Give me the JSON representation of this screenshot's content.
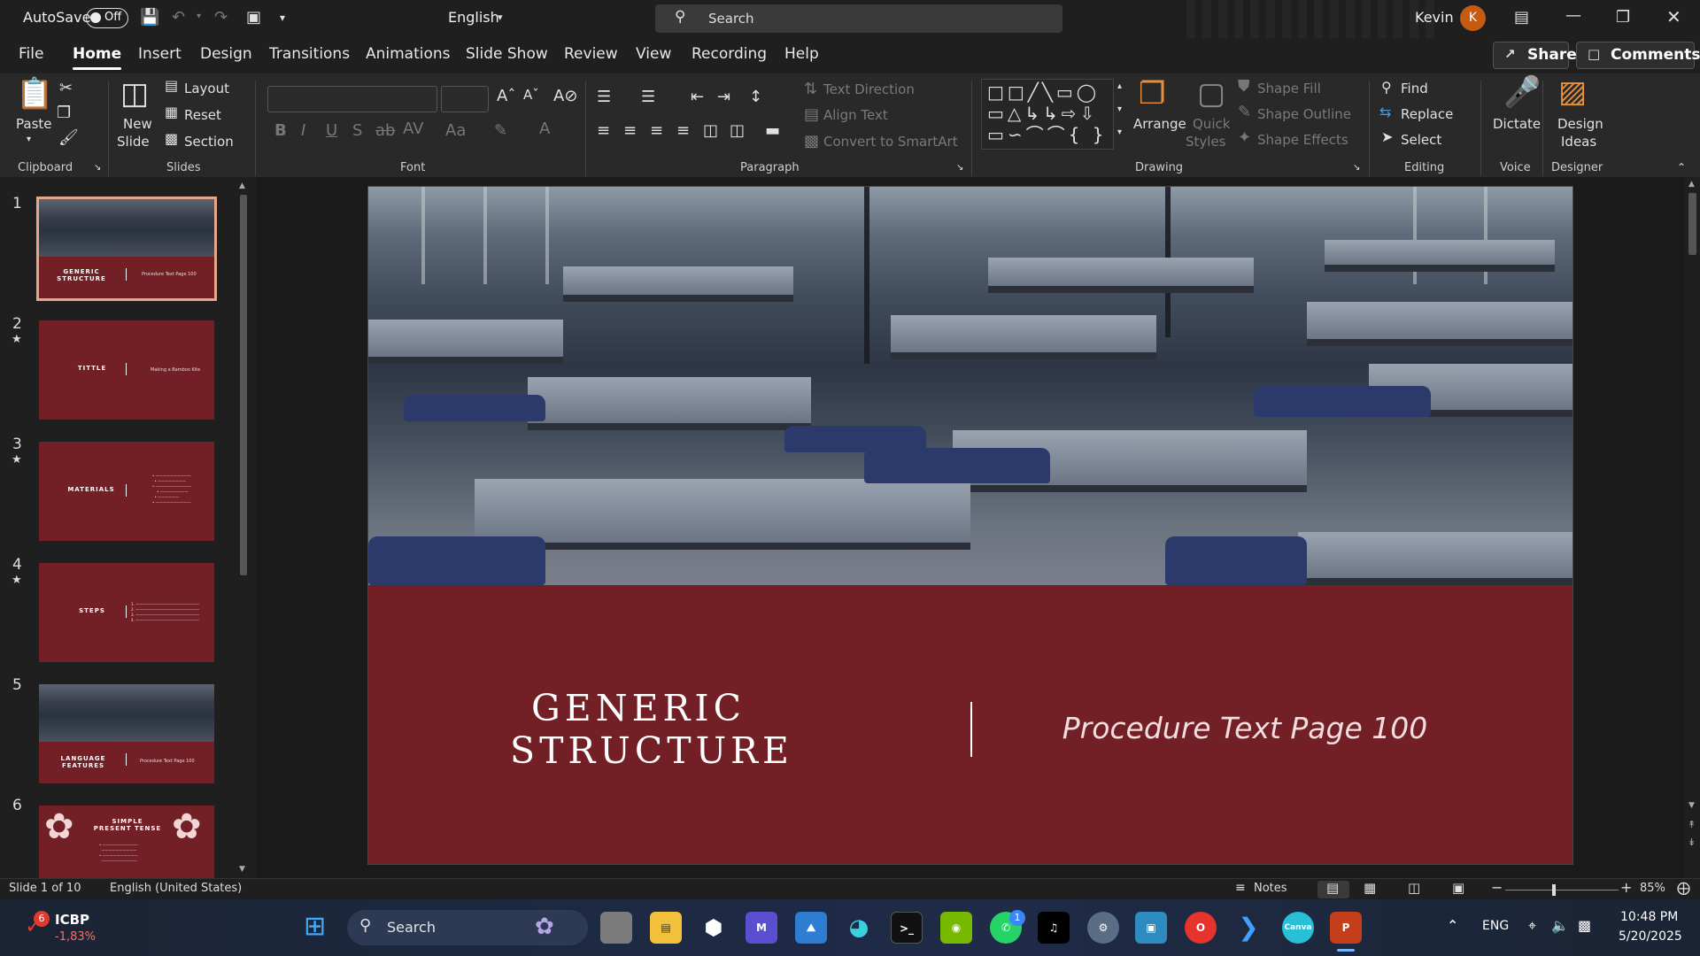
{
  "titlebar": {
    "autosave_label": "AutoSave",
    "autosave_state": "Off",
    "language": "English",
    "search_placeholder": "Search",
    "user_name": "Kevin",
    "user_initial": "K"
  },
  "menu": {
    "tabs": [
      "File",
      "Home",
      "Insert",
      "Design",
      "Transitions",
      "Animations",
      "Slide Show",
      "Review",
      "View",
      "Recording",
      "Help"
    ],
    "active_tab": "Home",
    "share_label": "Share",
    "comments_label": "Comments"
  },
  "ribbon": {
    "clipboard": {
      "paste": "Paste",
      "group": "Clipboard"
    },
    "slides": {
      "new_slide_1": "New",
      "new_slide_2": "Slide",
      "layout": "Layout",
      "reset": "Reset",
      "section": "Section",
      "group": "Slides"
    },
    "font": {
      "group": "Font"
    },
    "paragraph": {
      "text_direction": "Text Direction",
      "align_text": "Align Text",
      "convert_smartart": "Convert to SmartArt",
      "group": "Paragraph"
    },
    "drawing": {
      "arrange": "Arrange",
      "quick_styles_1": "Quick",
      "quick_styles_2": "Styles",
      "shape_fill": "Shape Fill",
      "shape_outline": "Shape Outline",
      "shape_effects": "Shape Effects",
      "group": "Drawing"
    },
    "editing": {
      "find": "Find",
      "replace": "Replace",
      "select": "Select",
      "group": "Editing"
    },
    "voice": {
      "dictate": "Dictate",
      "group": "Voice"
    },
    "designer": {
      "design_ideas_1": "Design",
      "design_ideas_2": "Ideas",
      "group": "Designer"
    }
  },
  "slides_panel": {
    "thumbnails": [
      {
        "num": "1",
        "title": "GENERIC STRUCTURE",
        "subtitle": "Procedure Text Page 100",
        "starred": false
      },
      {
        "num": "2",
        "title": "TITTLE",
        "subtitle": "Making a Bamboo Kite",
        "starred": true
      },
      {
        "num": "3",
        "title": "MATERIALS",
        "subtitle": "",
        "starred": true
      },
      {
        "num": "4",
        "title": "STEPS",
        "subtitle": "",
        "starred": true
      },
      {
        "num": "5",
        "title": "LANGUAGE FEATURES",
        "subtitle": "Procedure Text Page 100",
        "starred": false
      },
      {
        "num": "6",
        "title": "SIMPLE PRESENT TENSE",
        "subtitle": "",
        "starred": false
      }
    ]
  },
  "slide": {
    "title_line1": "GENERIC",
    "title_line2": "STRUCTURE",
    "subtitle": "Procedure Text Page 100"
  },
  "status": {
    "slide_counter": "Slide 1 of 10",
    "language": "English (United States)",
    "notes": "Notes",
    "zoom": "85%",
    "zoom_level": 0.85
  },
  "taskbar": {
    "stock_name": "ICBP",
    "stock_change": "-1,83%",
    "stock_badge": "6",
    "search_label": "Search",
    "whatsapp_badge": "1",
    "lang": "ENG",
    "time": "10:48 PM",
    "date": "5/20/2025"
  },
  "colors": {
    "slide_bg": "#721f26",
    "accent_avatar": "#c55a11",
    "selected_thumb_border": "#e7a58b",
    "app_bg": "#1f1f1f"
  }
}
